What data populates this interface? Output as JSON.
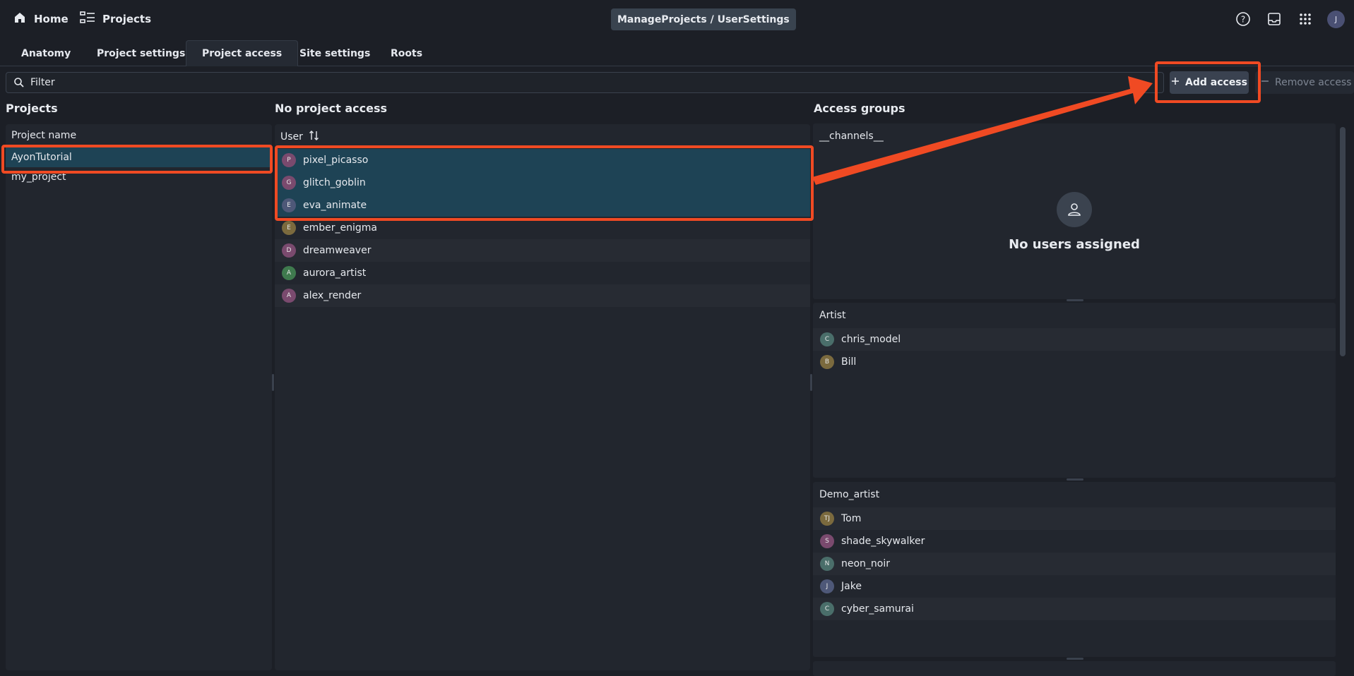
{
  "header": {
    "home_label": "Home",
    "projects_label": "Projects",
    "breadcrumb": "ManageProjects / UserSettings",
    "user_initial": "J"
  },
  "tabs": [
    {
      "label": "Anatomy",
      "active": false
    },
    {
      "label": "Project settings",
      "active": false
    },
    {
      "label": "Project access",
      "active": true
    },
    {
      "label": "Site settings",
      "active": false
    },
    {
      "label": "Roots",
      "active": false
    }
  ],
  "filter": {
    "placeholder": "Filter",
    "value": ""
  },
  "toolbar": {
    "add_label": "Add access",
    "remove_label": "Remove access"
  },
  "projects": {
    "title": "Projects",
    "column": "Project name",
    "items": [
      {
        "name": "AyonTutorial",
        "selected": true
      },
      {
        "name": "my_project",
        "selected": false
      }
    ]
  },
  "no_access": {
    "title": "No project access",
    "column": "User",
    "users": [
      {
        "initial": "P",
        "name": "pixel_picasso",
        "color": "#7a4a6e",
        "selected": true
      },
      {
        "initial": "G",
        "name": "glitch_goblin",
        "color": "#7a4a6e",
        "selected": true
      },
      {
        "initial": "E",
        "name": "eva_animate",
        "color": "#4e5878",
        "selected": true
      },
      {
        "initial": "E",
        "name": "ember_enigma",
        "color": "#7b6a3e",
        "selected": false
      },
      {
        "initial": "D",
        "name": "dreamweaver",
        "color": "#7a4a6e",
        "selected": false
      },
      {
        "initial": "A",
        "name": "aurora_artist",
        "color": "#3f7a4e",
        "selected": false
      },
      {
        "initial": "A",
        "name": "alex_render",
        "color": "#7a4a6e",
        "selected": false
      }
    ]
  },
  "access_groups": {
    "title": "Access groups",
    "groups": [
      {
        "name": "__channels__",
        "empty_text": "No users assigned",
        "users": []
      },
      {
        "name": "Artist",
        "users": [
          {
            "initial": "C",
            "name": "chris_model",
            "color": "#4a6e6a"
          },
          {
            "initial": "B",
            "name": "Bill",
            "color": "#7b6a3e"
          }
        ]
      },
      {
        "name": "Demo_artist",
        "users": [
          {
            "initial": "TJ",
            "name": "Tom",
            "color": "#7b6a3e"
          },
          {
            "initial": "S",
            "name": "shade_skywalker",
            "color": "#7a4a6e"
          },
          {
            "initial": "N",
            "name": "neon_noir",
            "color": "#4a6e6a"
          },
          {
            "initial": "J",
            "name": "Jake",
            "color": "#4e5878"
          },
          {
            "initial": "C",
            "name": "cyber_samurai",
            "color": "#4a6e6a"
          }
        ]
      }
    ]
  },
  "colors": {
    "accent_annotation": "#f04a23",
    "selected_row": "#1e4355"
  }
}
